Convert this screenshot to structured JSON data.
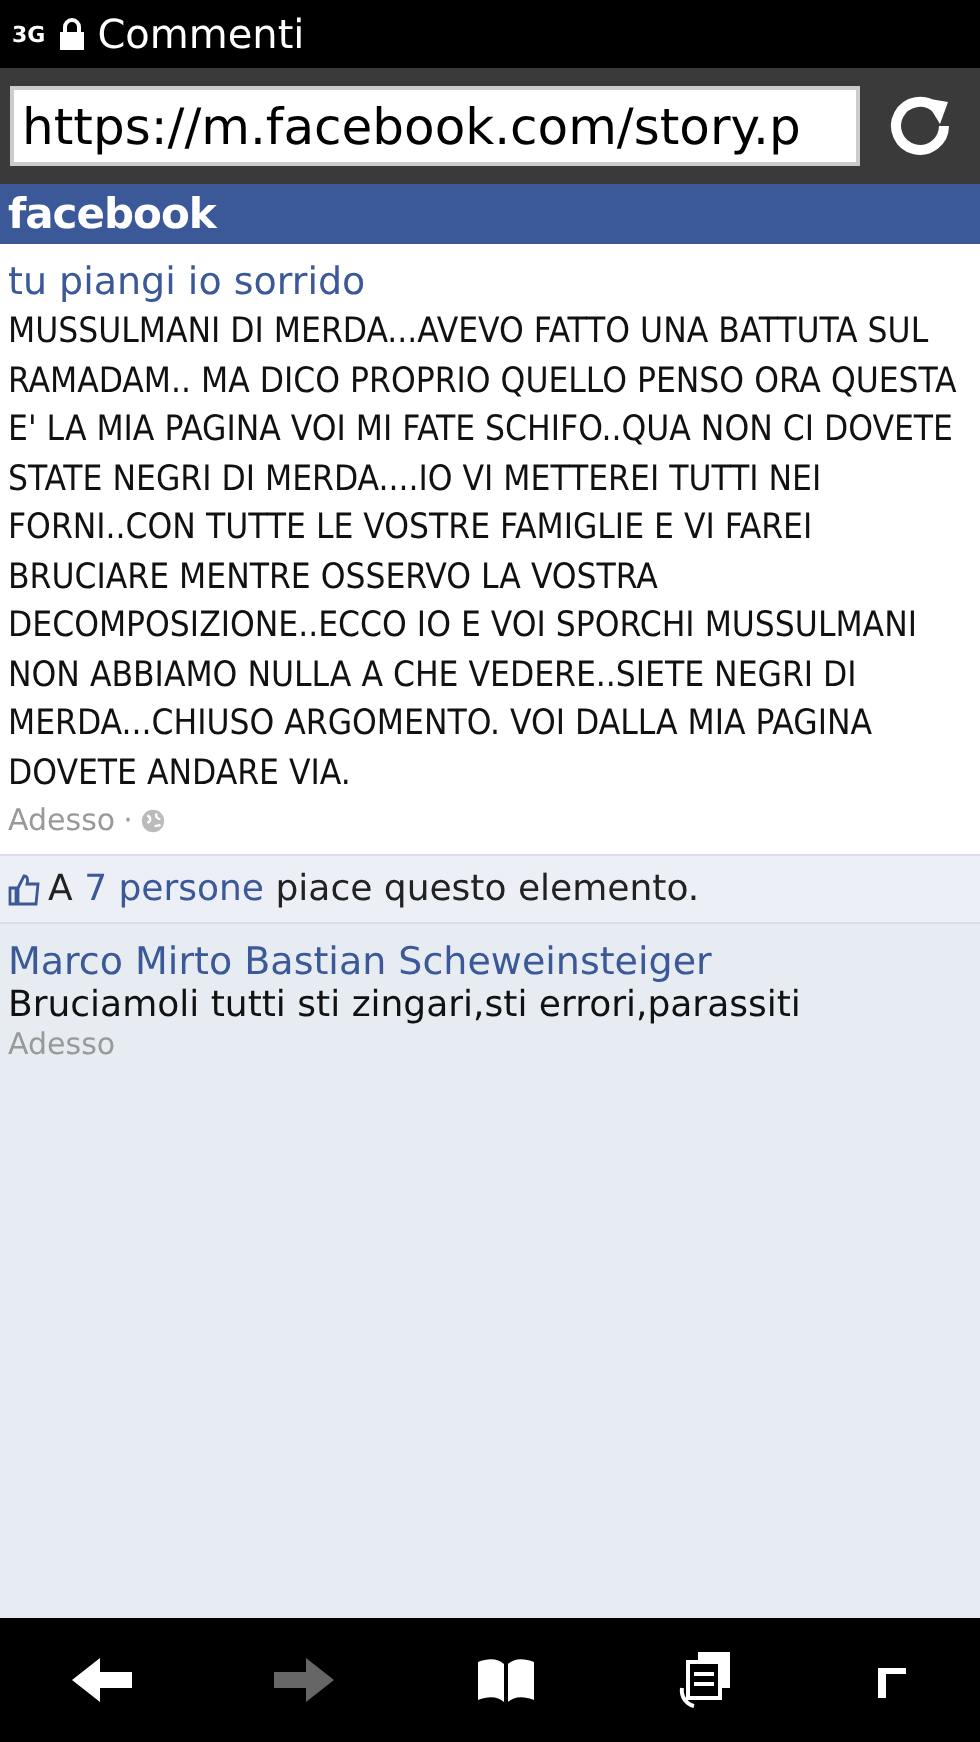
{
  "status_bar": {
    "network": "3G",
    "title": "Commenti"
  },
  "address_bar": {
    "value": "https://m.facebook.com/story.p"
  },
  "header": {
    "logo": "facebook"
  },
  "post": {
    "author": "tu piangi io sorrido",
    "text": "MUSSULMANI DI MERDA...AVEVO FATTO UNA BATTUTA SUL RAMADAM.. MA DICO PROPRIO QUELLO PENSO ORA QUESTA E' LA MIA PAGINA VOI MI FATE SCHIFO..QUA NON CI DOVETE STATE NEGRI DI MERDA....IO VI METTEREI TUTTI NEI FORNI..CON TUTTE LE VOSTRE FAMIGLIE E VI FAREI BRUCIARE MENTRE OSSERVO LA VOSTRA DECOMPOSIZIONE..ECCO IO E VOI SPORCHI MUSSULMANI NON ABBIAMO NULLA A CHE VEDERE..SIETE NEGRI DI MERDA...CHIUSO ARGOMENTO. VOI DALLA MIA PAGINA DOVETE ANDARE VIA.",
    "time": "Adesso",
    "separator": "·"
  },
  "likes": {
    "prefix": "A",
    "link": "7 persone",
    "suffix": "piace questo elemento."
  },
  "comments": [
    {
      "author": "Marco Mirto Bastian Scheweinsteiger",
      "text": "Bruciamoli tutti sti zingari,sti errori,parassiti",
      "time": "Adesso"
    }
  ]
}
